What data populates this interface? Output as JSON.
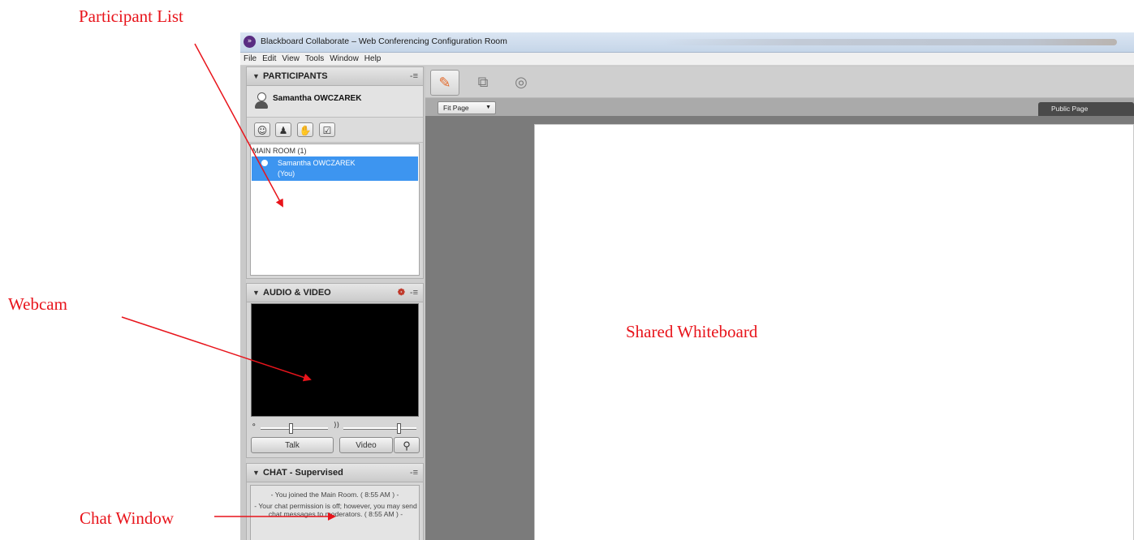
{
  "annotations": {
    "participant_list": "Participant List",
    "webcam": "Webcam",
    "chat_window": "Chat Window",
    "shared_whiteboard": "Shared Whiteboard"
  },
  "window": {
    "title": "Blackboard Collaborate – Web Conferencing Configuration Room",
    "app_icon": "blackboard-collaborate-icon"
  },
  "menu": [
    "File",
    "Edit",
    "View",
    "Tools",
    "Window",
    "Help"
  ],
  "participants": {
    "header": "PARTICIPANTS",
    "user_name": "Samantha OWCZAREK",
    "status_icons": [
      "emoticon-icon",
      "profile-icon",
      "raise-hand-icon",
      "poll-icon"
    ],
    "room_label": "MAIN ROOM (1)",
    "list": [
      {
        "name": "Samantha OWCZAREK",
        "tag": "(You)"
      }
    ]
  },
  "audio_video": {
    "header": "AUDIO & VIDEO",
    "talk_label": "Talk",
    "video_label": "Video",
    "mic_level": 0.45,
    "speaker_level": 0.75
  },
  "chat": {
    "header": "CHAT - Supervised",
    "messages": [
      "- You joined the Main Room. ( 8:55 AM ) -",
      "- Your chat permission is off; however, you may send chat messages to moderators. ( 8:55 AM ) -"
    ]
  },
  "whiteboard": {
    "zoom_label": "Fit Page",
    "page_tab": "Public Page",
    "tools": [
      "whiteboard-icon",
      "application-share-icon",
      "web-tour-icon"
    ]
  },
  "colors": {
    "annotation": "#e8141b",
    "selection": "#3d95f0",
    "brand": "#5a2d82"
  }
}
